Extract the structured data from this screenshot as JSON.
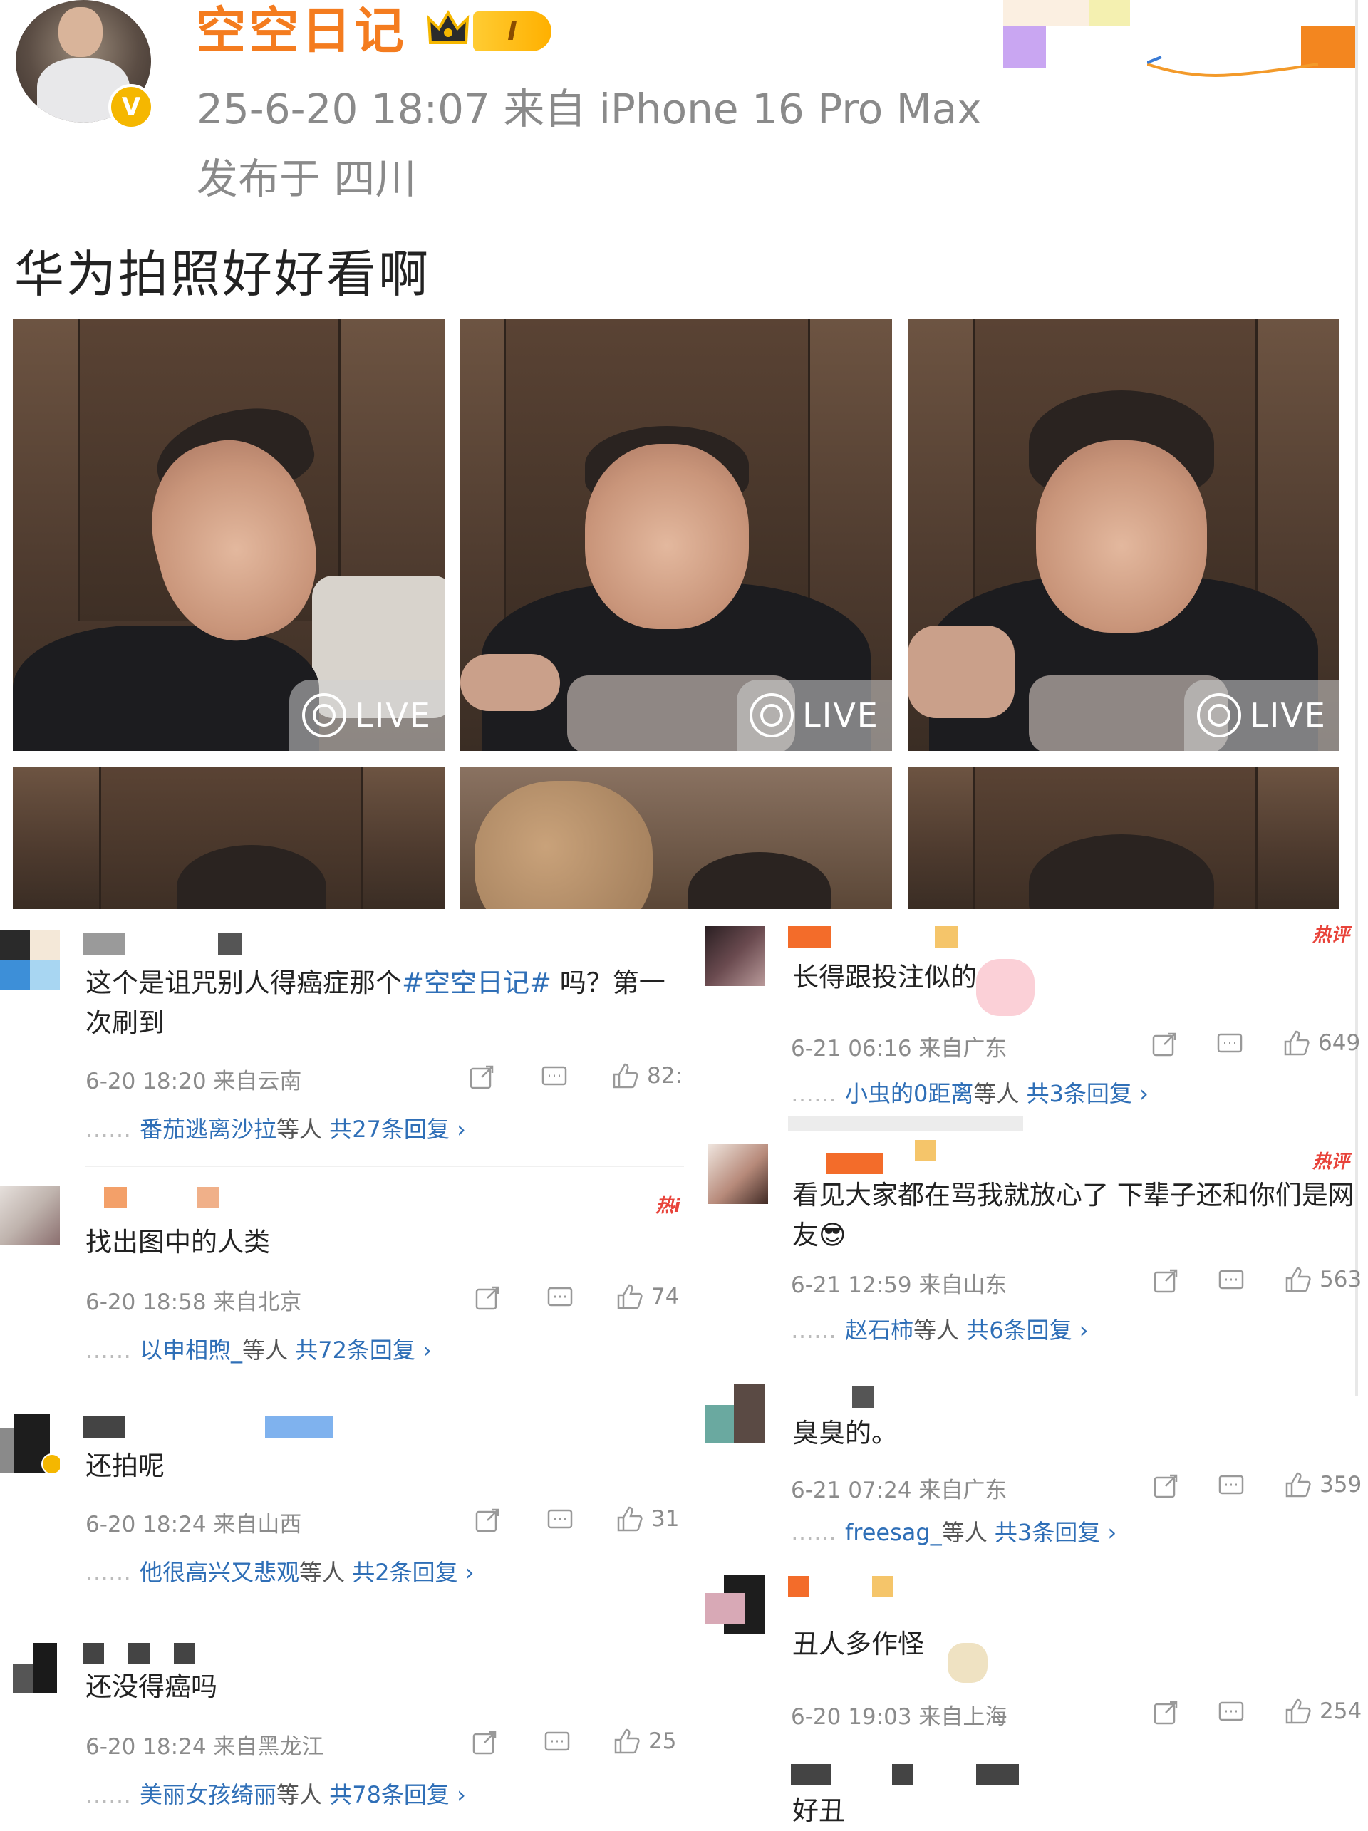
{
  "post": {
    "username": "空空日记",
    "level_badge": "I",
    "timestamp_source": "25-6-20 18:07  来自 iPhone 16 Pro Max",
    "location": "发布于 四川",
    "text": "华为拍照好好看啊",
    "live_label": "LIVE",
    "verified_badge": "V"
  },
  "comments_left": [
    {
      "text_before": "这个是诅咒别人得癌症那个",
      "hashtag": "#空空日记#",
      "text_after": " 吗？第一次刷到",
      "meta": "6-20 18:20 来自云南",
      "likes": "82:",
      "reply_user": "番茄逃离沙拉",
      "reply_mid": "等人",
      "reply_total": "共27条回复 ›"
    },
    {
      "text": "找出图中的人类",
      "hot": "热i",
      "meta": "6-20 18:58 来自北京",
      "likes": "74",
      "reply_user": "以申相煦_",
      "reply_mid": "等人",
      "reply_total": "共72条回复 ›"
    },
    {
      "text": "还拍呢",
      "meta": "6-20 18:24 来自山西",
      "likes": "31",
      "reply_user": "他很高兴又悲观",
      "reply_mid": "等人",
      "reply_total": "共2条回复 ›"
    },
    {
      "text": "还没得癌吗",
      "meta": "6-20 18:24 来自黑龙江",
      "likes": "25",
      "reply_user": "美丽女孩绮丽",
      "reply_mid": "等人",
      "reply_total": "共78条回复 ›"
    }
  ],
  "comments_right": [
    {
      "text": "长得跟投注似的",
      "hot": "热评",
      "meta": "6-21 06:16 来自广东",
      "likes": "649",
      "reply_user": "小虫的0距离",
      "reply_mid": "等人",
      "reply_total": "共3条回复 ›"
    },
    {
      "text": "看见大家都在骂我就放心了 下辈子还和你们是网友😎",
      "hot": "热评",
      "meta": "6-21 12:59 来自山东",
      "likes": "563",
      "reply_user": "赵石柿",
      "reply_mid": "等人",
      "reply_total": "共6条回复 ›"
    },
    {
      "text": "臭臭的。",
      "meta": "6-21 07:24 来自广东",
      "likes": "359",
      "reply_user": "freesag_",
      "reply_mid": "等人",
      "reply_total": "共3条回复 ›"
    },
    {
      "text": "丑人多作怪",
      "meta": "6-20 19:03 来自上海",
      "likes": "254"
    },
    {
      "text": "好丑"
    }
  ],
  "colors": {
    "username": "#f47c1f",
    "link": "#2f6fb7",
    "meta": "#8b8b8b",
    "hot": "#e8433a"
  }
}
